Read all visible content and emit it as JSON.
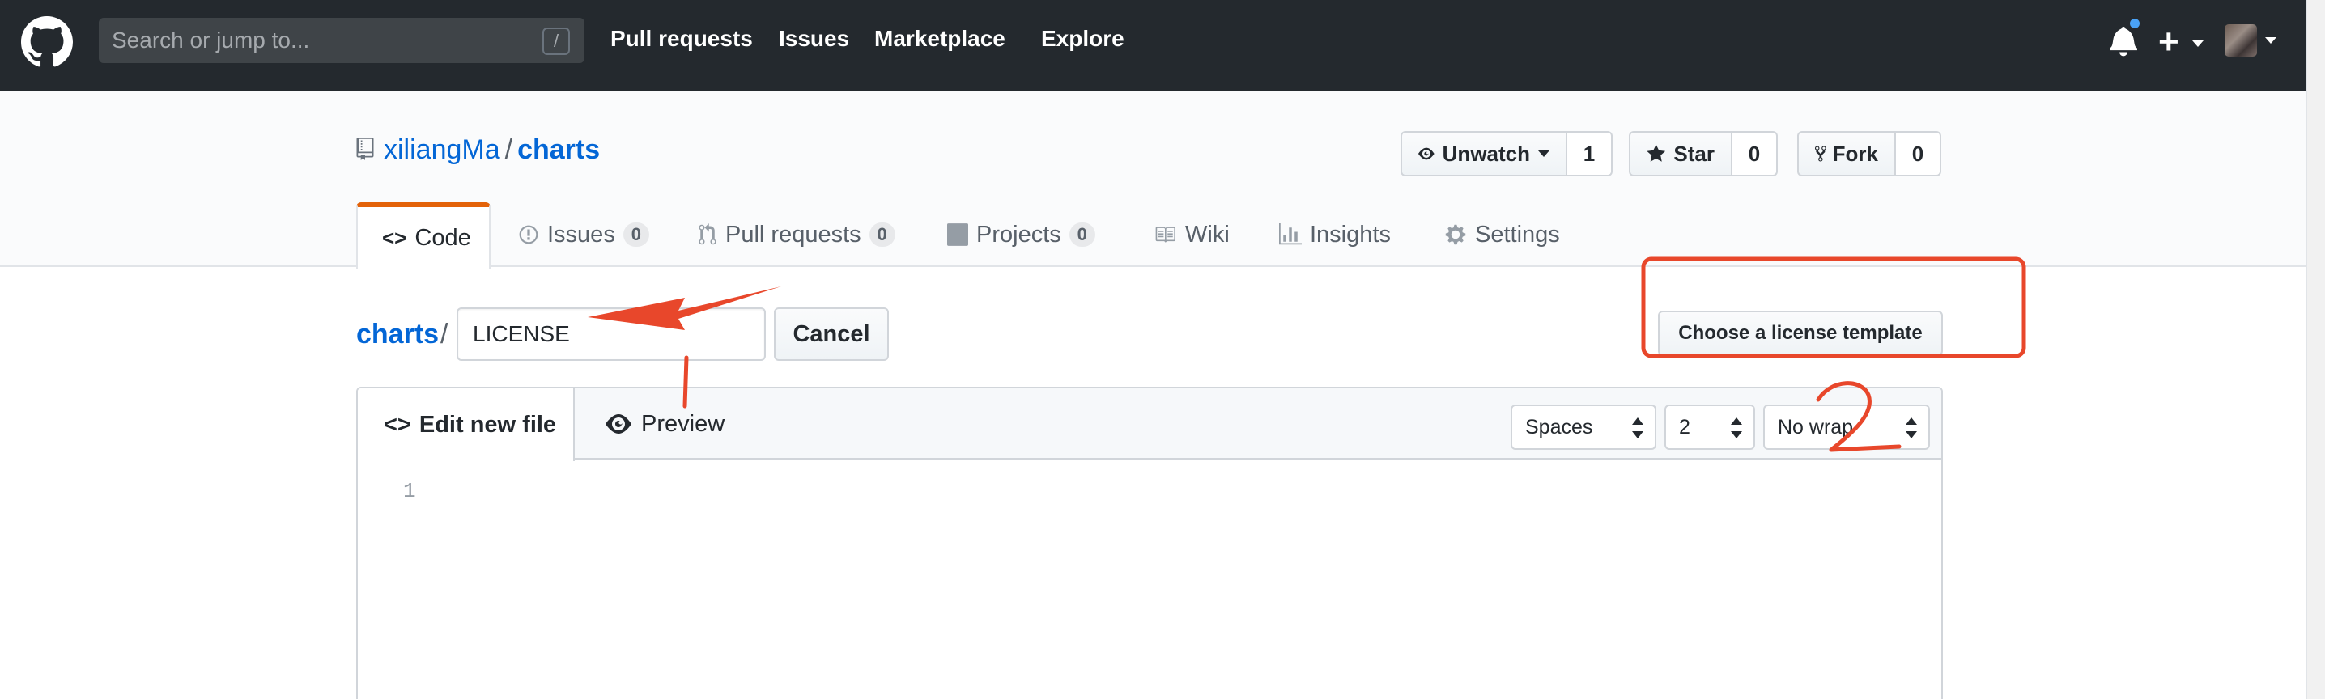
{
  "header": {
    "search_placeholder": "Search or jump to...",
    "search_shortcut": "/",
    "nav": [
      "Pull requests",
      "Issues",
      "Marketplace",
      "Explore"
    ]
  },
  "repo": {
    "owner": "xiliangMa",
    "separator": "/",
    "name": "charts",
    "unwatch_label": "Unwatch",
    "watch_count": "1",
    "star_label": "Star",
    "star_count": "0",
    "fork_label": "Fork",
    "fork_count": "0"
  },
  "tabs": [
    {
      "label": "Code",
      "icon": "code-icon"
    },
    {
      "label": "Issues",
      "icon": "issue-icon",
      "count": "0"
    },
    {
      "label": "Pull requests",
      "icon": "pull-request-icon",
      "count": "0"
    },
    {
      "label": "Projects",
      "icon": "project-icon",
      "count": "0"
    },
    {
      "label": "Wiki",
      "icon": "book-icon"
    },
    {
      "label": "Insights",
      "icon": "graph-icon"
    },
    {
      "label": "Settings",
      "icon": "gear-icon"
    }
  ],
  "editor": {
    "breadcrumb_repo": "charts",
    "breadcrumb_sep": "/",
    "filename_value": "LICENSE",
    "cancel_label": "Cancel",
    "license_template_label": "Choose a license template",
    "edit_tab_label": "Edit new file",
    "preview_tab_label": "Preview",
    "indent_mode": "Spaces",
    "indent_size": "2",
    "wrap_mode": "No wrap",
    "line_number": "1"
  },
  "annotations": {
    "step_label": "2",
    "color": "#e8472b"
  }
}
